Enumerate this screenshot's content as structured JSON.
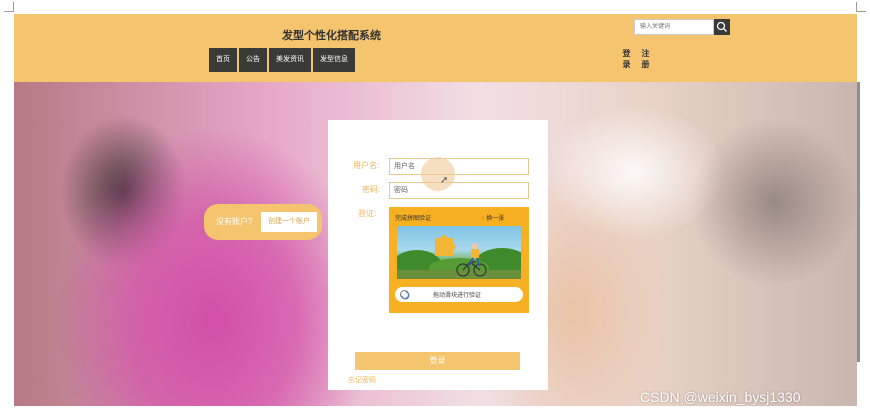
{
  "header": {
    "title": "发型个性化搭配系统",
    "nav": [
      "首页",
      "公告",
      "美发资讯",
      "发型信息"
    ],
    "search_placeholder": "输入关键词",
    "login_label": "登录",
    "register_label": "注册"
  },
  "signup": {
    "prompt": "没有账户?",
    "link": "创建一个账户"
  },
  "form": {
    "username_label": "用户名:",
    "username_placeholder": "用户名",
    "password_label": "密码:",
    "password_placeholder": "密码",
    "captcha_label": "验证:",
    "captcha_title": "完成拼图验证",
    "captcha_refresh": "换一张",
    "captcha_slider_hint": "拖动滑块进行验证",
    "login_button": "登录",
    "forgot_link": "忘记密码"
  },
  "watermark": "CSDN @weixin_bysj1330",
  "icons": {
    "search": "search-icon",
    "refresh": "refresh-icon",
    "cursor": "cursor-icon",
    "slider_knob": "loading-icon"
  },
  "colors": {
    "header_bg": "#f5c46f",
    "nav_bg": "#3a3a36",
    "captcha_bg": "#f7b021",
    "accent_text": "#f0b25a"
  }
}
